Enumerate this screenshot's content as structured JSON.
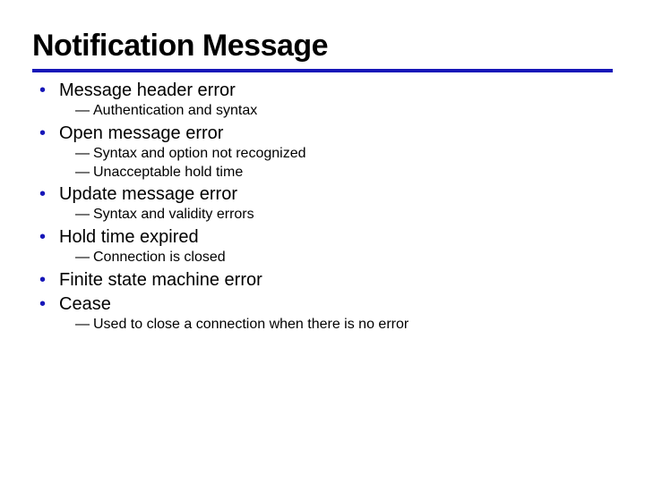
{
  "title": "Notification Message",
  "items": [
    {
      "label": "Message header error",
      "sub": [
        "Authentication and syntax"
      ]
    },
    {
      "label": "Open message error",
      "sub": [
        "Syntax and option not recognized",
        "Unacceptable hold time"
      ]
    },
    {
      "label": "Update message error",
      "sub": [
        "Syntax and validity errors"
      ]
    },
    {
      "label": "Hold time expired",
      "sub": [
        "Connection is closed"
      ]
    },
    {
      "label": "Finite state machine error",
      "sub": []
    },
    {
      "label": "Cease",
      "sub": [
        "Used to close a connection when there is no error"
      ]
    }
  ]
}
